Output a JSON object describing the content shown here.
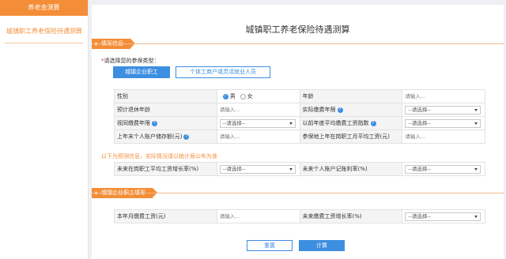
{
  "sidebar": {
    "header": "养老金测算",
    "item": "城镇职工养老保险待遇测算"
  },
  "page": {
    "title": "城镇职工养老保险待遇测算"
  },
  "section1": {
    "tag": "填写信息",
    "type_prompt_req": "*",
    "type_prompt": "请选择您的参保类型：",
    "type_buttons": [
      "城镇企业职工",
      "个体工商户或灵活就业人员"
    ]
  },
  "basic_table": {
    "rows": [
      {
        "l1": "性别",
        "gender_male": "男",
        "gender_female": "女",
        "l3": "年龄",
        "v4": "请输入..."
      },
      {
        "l1": "预计退休年龄",
        "v2": "请输入...",
        "l3": "实际缴费年限",
        "v4": "--请选择--"
      },
      {
        "l1": "视同缴费年限",
        "v2": "--请选择--",
        "l3": "以前年度平均缴费工资指数",
        "v4": "--请选择--"
      },
      {
        "l1": "上年末个人账户储存额(元)",
        "v2": "请输入...",
        "l3": "参保地上年在岗职工月平均工资(元)",
        "v4": "请输入..."
      }
    ]
  },
  "notice": "以下为预测信息，实际情况请以统计局公布为准",
  "forecast_table": {
    "l1": "未来在岗职工平均工资增长率(%)",
    "v2": "--请选择--",
    "l3": "未来个人账户记账利率(%)",
    "v4": "--请选择--"
  },
  "section2": {
    "tag": "城镇企业职工填写"
  },
  "enterprise_table": {
    "l1": "本年月缴费工资(元)",
    "v2": "请输入...",
    "l3": "未来缴费工资增长率(%)",
    "v4": "--请选择--"
  },
  "actions": {
    "reset": "重置",
    "calculate": "计算"
  },
  "icons": {
    "help": "help-icon",
    "radio_checked": "radio-checked-icon",
    "dropdown": "chevron-down-icon"
  },
  "colors": {
    "accent": "#f48d37",
    "primary": "#3d8ee0"
  }
}
